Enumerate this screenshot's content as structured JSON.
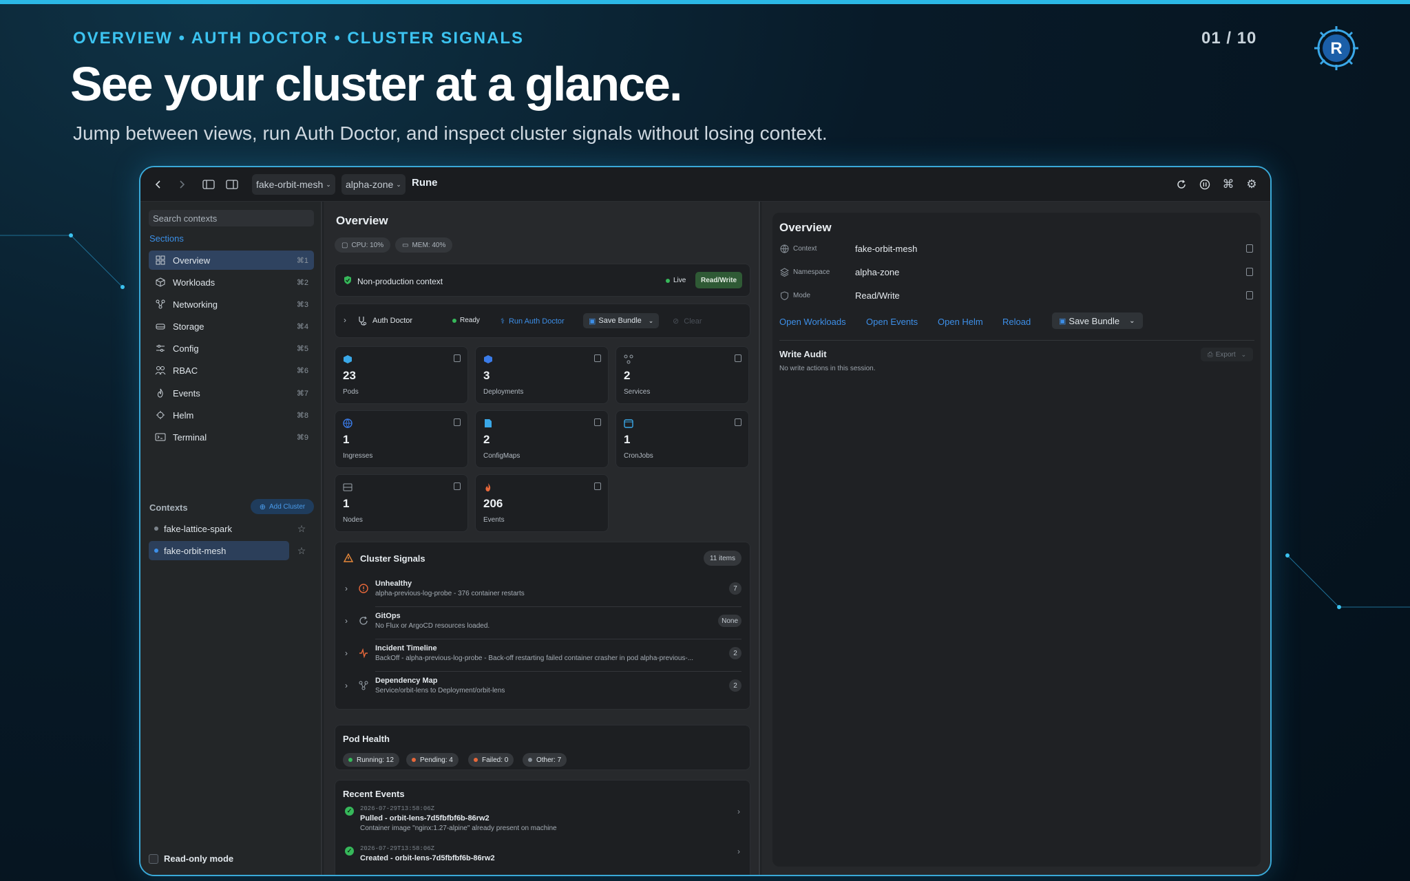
{
  "hero": {
    "eyebrow": "OVERVIEW • AUTH DOCTOR • CLUSTER SIGNALS",
    "counter": "01 / 10",
    "title": "See your cluster at a glance.",
    "subtitle": "Jump between views, run Auth Doctor, and inspect cluster signals without losing context."
  },
  "titlebar": {
    "context_select": "fake-orbit-mesh",
    "namespace_select": "alpha-zone",
    "app_name": "Rune"
  },
  "sidebar": {
    "search_placeholder": "Search contexts",
    "sections_label": "Sections",
    "items": [
      {
        "label": "Overview",
        "shortcut": "⌘1",
        "icon": "grid-icon"
      },
      {
        "label": "Workloads",
        "shortcut": "⌘2",
        "icon": "cube-icon"
      },
      {
        "label": "Networking",
        "shortcut": "⌘3",
        "icon": "network-icon"
      },
      {
        "label": "Storage",
        "shortcut": "⌘4",
        "icon": "drive-icon"
      },
      {
        "label": "Config",
        "shortcut": "⌘5",
        "icon": "sliders-icon"
      },
      {
        "label": "RBAC",
        "shortcut": "⌘6",
        "icon": "users-icon"
      },
      {
        "label": "Events",
        "shortcut": "⌘7",
        "icon": "flame-icon"
      },
      {
        "label": "Helm",
        "shortcut": "⌘8",
        "icon": "helm-icon"
      },
      {
        "label": "Terminal",
        "shortcut": "⌘9",
        "icon": "terminal-icon"
      }
    ],
    "contexts_label": "Contexts",
    "add_cluster": "Add Cluster",
    "contexts": [
      {
        "name": "fake-lattice-spark",
        "active": false
      },
      {
        "name": "fake-orbit-mesh",
        "active": true
      }
    ],
    "read_only_label": "Read-only mode"
  },
  "main": {
    "title": "Overview",
    "cpu": "CPU: 10%",
    "mem": "MEM: 40%",
    "context_banner": {
      "title": "Non-production context",
      "live": "Live",
      "mode": "Read/Write"
    },
    "auth_doctor": {
      "label": "Auth Doctor",
      "status": "Ready",
      "run": "Run Auth Doctor",
      "save": "Save Bundle",
      "clear": "Clear"
    },
    "stats": [
      {
        "value": "23",
        "label": "Pods",
        "color": "#3aa8e8"
      },
      {
        "value": "3",
        "label": "Deployments",
        "color": "#3a7be8"
      },
      {
        "value": "2",
        "label": "Services",
        "color": "#9aa3ab"
      },
      {
        "value": "1",
        "label": "Ingresses",
        "color": "#3a7be8"
      },
      {
        "value": "2",
        "label": "ConfigMaps",
        "color": "#3aa8e8"
      },
      {
        "value": "1",
        "label": "CronJobs",
        "color": "#3aa8e8"
      },
      {
        "value": "1",
        "label": "Nodes",
        "color": "#9aa3ab"
      },
      {
        "value": "206",
        "label": "Events",
        "color": "#e8683a"
      }
    ],
    "signals": {
      "title": "Cluster Signals",
      "count": "11 items",
      "rows": [
        {
          "title": "Unhealthy",
          "desc": "alpha-previous-log-probe - 376 container restarts",
          "count": "7",
          "color": "#e8683a"
        },
        {
          "title": "GitOps",
          "desc": "No Flux or ArgoCD resources loaded.",
          "count": "None",
          "color": "#9aa3ab"
        },
        {
          "title": "Incident Timeline",
          "desc": "BackOff - alpha-previous-log-probe - Back-off restarting failed container crasher in pod alpha-previous-...",
          "count": "2",
          "color": "#e8683a"
        },
        {
          "title": "Dependency Map",
          "desc": "Service/orbit-lens to Deployment/orbit-lens",
          "count": "2",
          "color": "#9aa3ab"
        }
      ]
    },
    "pod_health": {
      "title": "Pod Health",
      "items": [
        {
          "label": "Running: 12",
          "color": "#36b85a"
        },
        {
          "label": "Pending: 4",
          "color": "#e8683a"
        },
        {
          "label": "Failed: 0",
          "color": "#e8683a"
        },
        {
          "label": "Other: 7",
          "color": "#8a929a"
        }
      ]
    },
    "events": {
      "title": "Recent Events",
      "items": [
        {
          "ts": "2026-07-29T13:58:06Z",
          "title": "Pulled - orbit-lens-7d5fbfbf6b-86rw2",
          "msg": "Container image \"nginx:1.27-alpine\" already present on machine"
        },
        {
          "ts": "2026-07-29T13:58:06Z",
          "title": "Created - orbit-lens-7d5fbfbf6b-86rw2",
          "msg": ""
        }
      ]
    }
  },
  "detail": {
    "title": "Overview",
    "fields": [
      {
        "key": "Context",
        "value": "fake-orbit-mesh"
      },
      {
        "key": "Namespace",
        "value": "alpha-zone"
      },
      {
        "key": "Mode",
        "value": "Read/Write"
      }
    ],
    "links": [
      "Open Workloads",
      "Open Events",
      "Open Helm",
      "Reload"
    ],
    "save": "Save Bundle",
    "audit_title": "Write Audit",
    "audit_empty": "No write actions in this session.",
    "export": "Export"
  }
}
